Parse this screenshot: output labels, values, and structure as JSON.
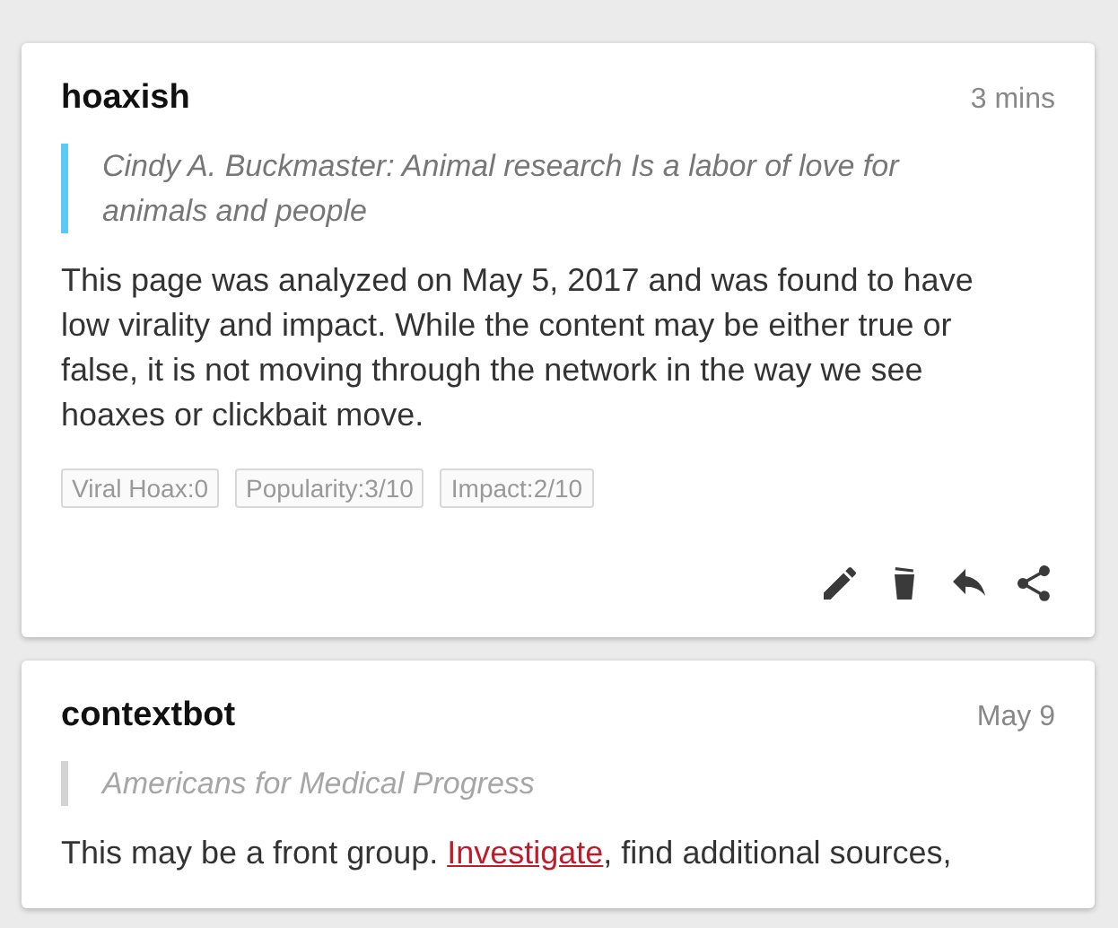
{
  "cards": [
    {
      "kind": "highlight",
      "user": "hoaxish",
      "time": "3 mins",
      "quote": "Cindy A. Buckmaster: Animal research Is a labor of love for animals and people",
      "body": [
        {
          "kind": "text",
          "text": "This page was analyzed on May 5, 2017 and was found to have low virality and impact. While the content may be either true or false, it is not moving through the network in the way we see hoaxes or clickbait move."
        }
      ],
      "tags": [
        "Viral Hoax:0",
        "Popularity:3/10",
        "Impact:2/10"
      ],
      "actions": {
        "edit": true,
        "delete": true,
        "reply": true,
        "share": true
      }
    },
    {
      "kind": "orphan",
      "user": "contextbot",
      "time": "May 9",
      "quote": "Americans for Medical Progress",
      "body": [
        {
          "kind": "text",
          "text": "This may be a front group. "
        },
        {
          "kind": "link",
          "text": "Investigate"
        },
        {
          "kind": "text",
          "text": ", find additional sources,"
        }
      ]
    }
  ]
}
